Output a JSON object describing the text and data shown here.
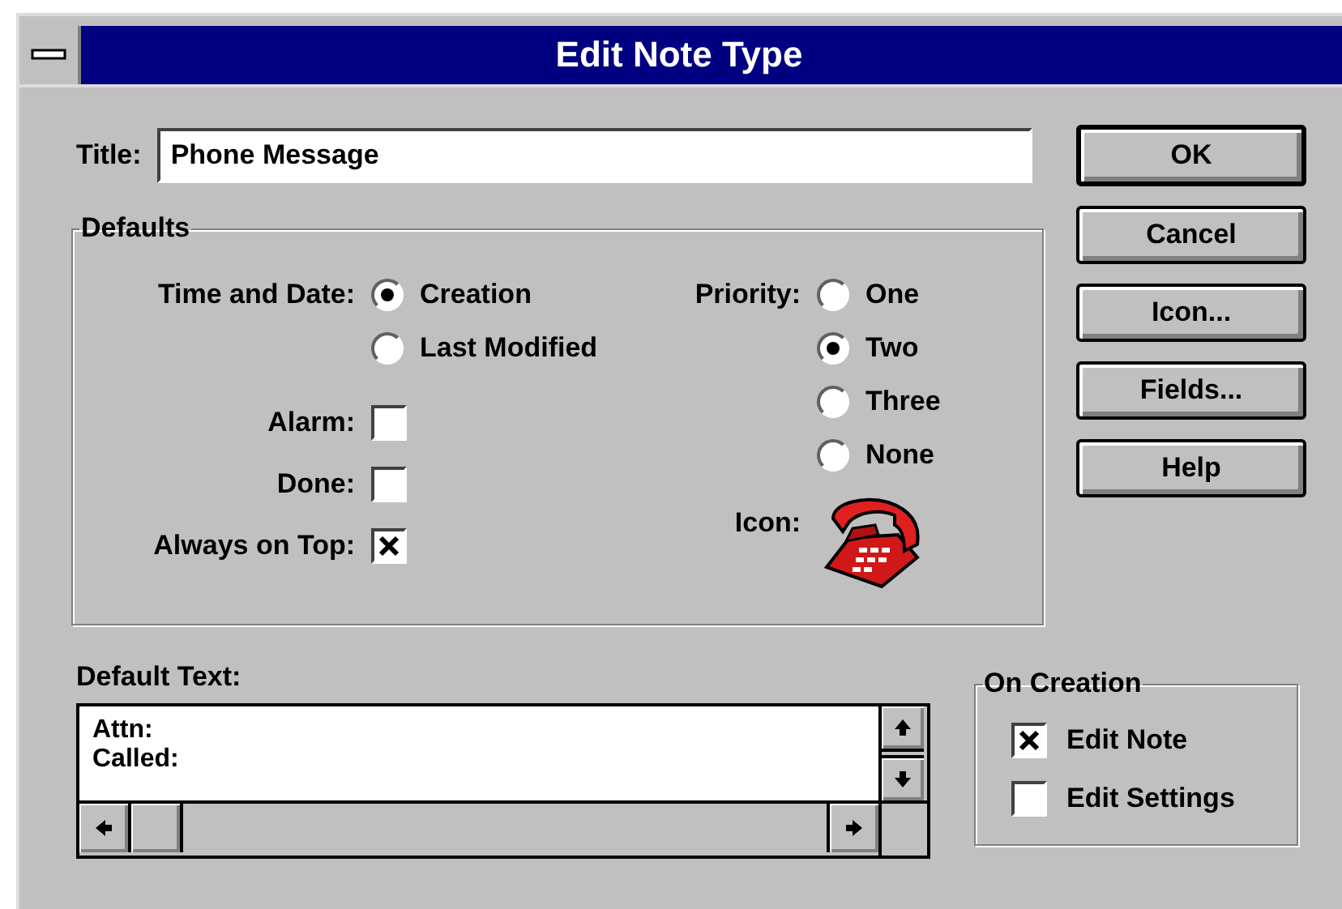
{
  "window": {
    "title": "Edit Note Type"
  },
  "title_field": {
    "label": "Title:",
    "value": "Phone Message"
  },
  "defaults": {
    "heading": "Defaults",
    "time_and_date": {
      "label": "Time and Date:",
      "options": [
        {
          "label": "Creation",
          "selected": true
        },
        {
          "label": "Last Modified",
          "selected": false
        }
      ]
    },
    "checkboxes": [
      {
        "label": "Alarm:",
        "checked": false
      },
      {
        "label": "Done:",
        "checked": false
      },
      {
        "label": "Always on Top:",
        "checked": true
      }
    ],
    "priority": {
      "label": "Priority:",
      "options": [
        {
          "label": "One",
          "selected": false
        },
        {
          "label": "Two",
          "selected": true
        },
        {
          "label": "Three",
          "selected": false
        },
        {
          "label": "None",
          "selected": false
        }
      ]
    },
    "icon": {
      "label": "Icon:"
    }
  },
  "default_text": {
    "label": "Default Text:",
    "lines": [
      "Attn:",
      "Called:"
    ]
  },
  "on_creation": {
    "heading": "On Creation",
    "options": [
      {
        "label": "Edit Note",
        "checked": true
      },
      {
        "label": "Edit Settings",
        "checked": false
      }
    ]
  },
  "buttons": [
    {
      "label": "OK",
      "default": true
    },
    {
      "label": "Cancel",
      "default": false
    },
    {
      "label": "Icon...",
      "default": false
    },
    {
      "label": "Fields...",
      "default": false
    },
    {
      "label": "Help",
      "default": false
    }
  ]
}
